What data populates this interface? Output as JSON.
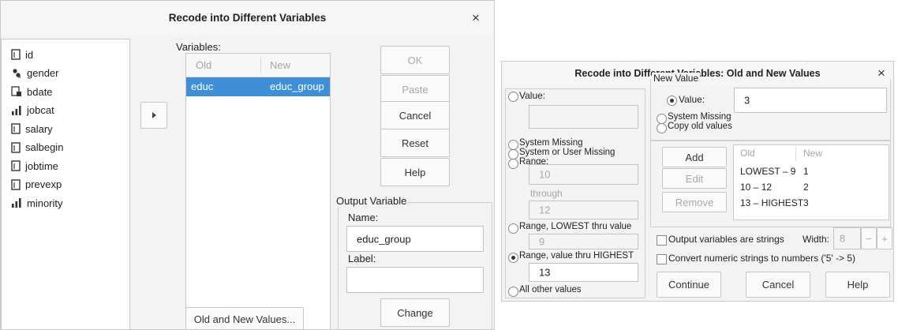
{
  "dialog1": {
    "title": "Recode into Different Variables",
    "variables_label": "Variables:",
    "source_variables": [
      {
        "name": "id",
        "icon": "scale-icon"
      },
      {
        "name": "gender",
        "icon": "nominal-string-icon"
      },
      {
        "name": "bdate",
        "icon": "date-icon"
      },
      {
        "name": "jobcat",
        "icon": "ordinal-icon"
      },
      {
        "name": "salary",
        "icon": "scale-icon"
      },
      {
        "name": "salbegin",
        "icon": "scale-icon"
      },
      {
        "name": "jobtime",
        "icon": "scale-icon"
      },
      {
        "name": "prevexp",
        "icon": "scale-icon"
      },
      {
        "name": "minority",
        "icon": "ordinal-icon"
      }
    ],
    "table": {
      "col_old": "Old",
      "col_new": "New",
      "rows": [
        {
          "old": "educ",
          "new": "educ_group"
        }
      ]
    },
    "buttons": {
      "ok": "OK",
      "paste": "Paste",
      "cancel": "Cancel",
      "reset": "Reset",
      "help": "Help",
      "old_new": "Old and New Values...",
      "change": "Change"
    },
    "output_variable": {
      "title": "Output Variable",
      "name_label": "Name:",
      "name_value": "educ_group",
      "label_label": "Label:",
      "label_value": ""
    },
    "close": "×",
    "colors": {
      "selection": "#3f8fd8",
      "selection_text": "#ffffff"
    }
  },
  "dialog2": {
    "title": "Recode into Different Variables: Old and New Values",
    "close": "×",
    "old_value": {
      "value_label": "Value:",
      "value_value": "",
      "system_missing": "System Missing",
      "system_or_user_missing": "System or User Missing",
      "range_label": "Range:",
      "range_from": "10",
      "through": "through",
      "range_to": "12",
      "lowest_thru_label": "Range, LOWEST thru value",
      "lowest_thru_value": "9",
      "value_thru_highest_label": "Range, value thru HIGHEST",
      "value_thru_highest_value": "13",
      "all_other": "All other values",
      "selected": "value_thru_highest"
    },
    "new_value": {
      "title": "New Value",
      "value_label": "Value:",
      "value_value": "3",
      "system_missing": "System Missing",
      "copy_old": "Copy old values",
      "selected": "value"
    },
    "mapping": {
      "col_old": "Old",
      "col_new": "New",
      "rows": [
        {
          "old": "LOWEST – 9",
          "new": "1"
        },
        {
          "old": "10 – 12",
          "new": "2"
        },
        {
          "old": "13 – HIGHEST",
          "new": "3"
        }
      ]
    },
    "buttons": {
      "add": "Add",
      "edit": "Edit",
      "remove": "Remove",
      "continue": "Continue",
      "cancel": "Cancel",
      "help": "Help"
    },
    "output_strings": {
      "label": "Output variables are strings",
      "width_label": "Width:",
      "width_value": "8",
      "minus": "−",
      "plus": "+"
    },
    "convert_numeric": "Convert numeric strings to numbers ('5' -> 5)"
  }
}
